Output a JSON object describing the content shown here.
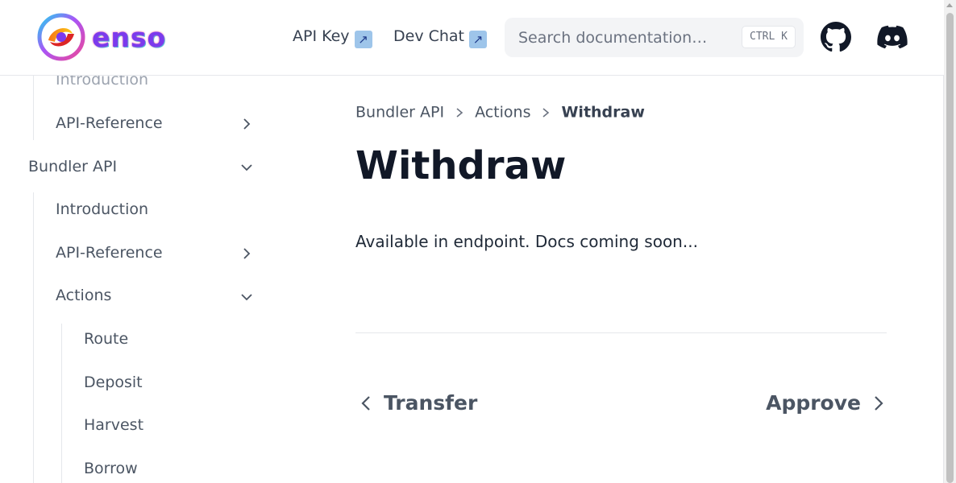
{
  "header": {
    "logo_text": "enso",
    "nav_links": [
      {
        "label": "API Key",
        "arrow": "↗"
      },
      {
        "label": "Dev Chat",
        "arrow": "↗"
      }
    ],
    "search": {
      "placeholder": "Search documentation…",
      "shortcut": "CTRL K"
    },
    "icons": [
      "github-icon",
      "discord-icon"
    ]
  },
  "sidebar": {
    "items": [
      {
        "label": "Introduction"
      },
      {
        "label": "API-Reference"
      },
      {
        "label": "Bundler API"
      },
      {
        "label": "Introduction"
      },
      {
        "label": "API-Reference"
      },
      {
        "label": "Actions"
      },
      {
        "label": "Route"
      },
      {
        "label": "Deposit"
      },
      {
        "label": "Harvest"
      },
      {
        "label": "Borrow"
      }
    ]
  },
  "breadcrumb": {
    "items": [
      "Bundler API",
      "Actions"
    ],
    "current": "Withdraw"
  },
  "main": {
    "title": "Withdraw",
    "body": "Available in endpoint. Docs coming soon..."
  },
  "pager": {
    "prev": "Transfer",
    "next": "Approve"
  },
  "colors": {
    "title": "#111827",
    "text": "#4b5563",
    "border": "#e5e7eb",
    "search_bg": "#f3f4f6"
  }
}
